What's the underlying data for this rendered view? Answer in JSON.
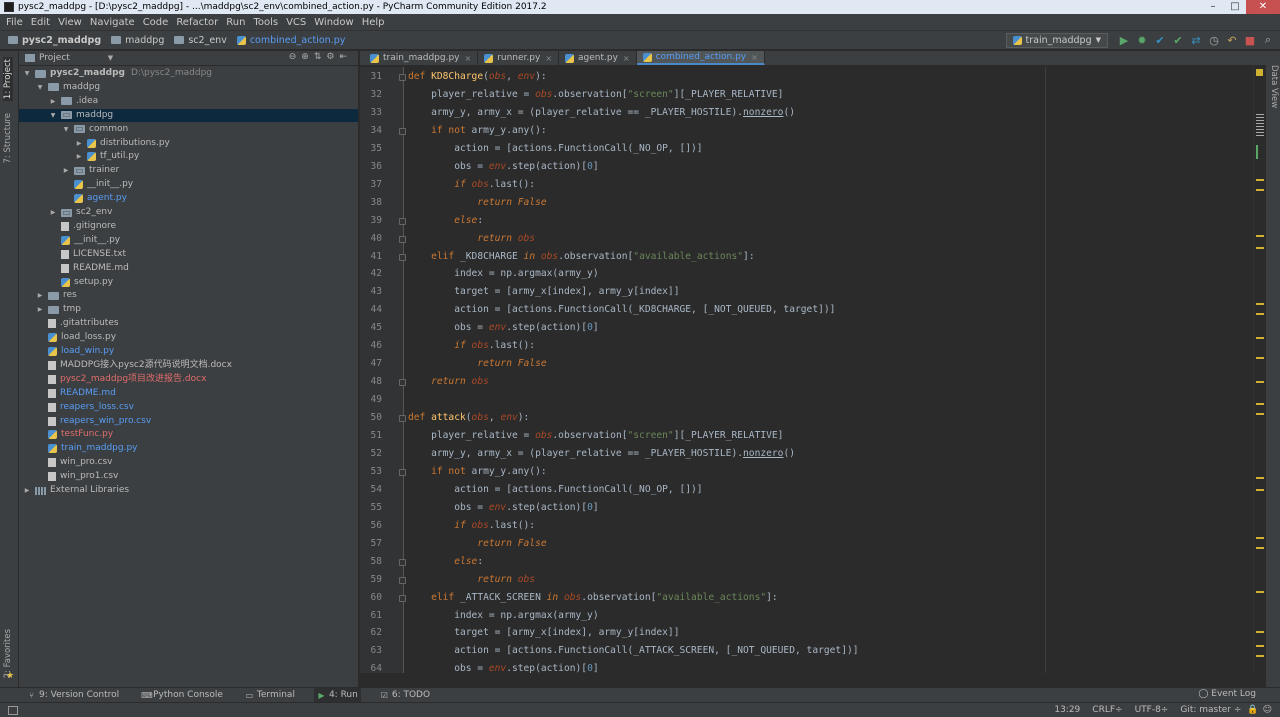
{
  "window": {
    "title": "pysc2_maddpg - [D:\\pysc2_maddpg] - ...\\maddpg\\sc2_env\\combined_action.py - PyCharm Community Edition 2017.2",
    "controls": [
      "–",
      "□",
      "✕"
    ]
  },
  "menu": [
    "File",
    "Edit",
    "View",
    "Navigate",
    "Code",
    "Refactor",
    "Run",
    "Tools",
    "VCS",
    "Window",
    "Help"
  ],
  "breadcrumb": [
    "pysc2_maddpg",
    "maddpg",
    "sc2_env",
    "combined_action.py"
  ],
  "toolbar": {
    "run_config": "train_maddpg",
    "icons": [
      "run-icon",
      "debug-icon",
      "vcs-update-icon",
      "vcs-commit-icon",
      "vcs-compare-icon",
      "vcs-history-icon",
      "revert-icon",
      "stop-icon",
      "search-everywhere-icon"
    ]
  },
  "left_stripe": {
    "project_tab": "1: Project",
    "structure_tab": "7: Structure",
    "favorites_tab": "2: Favorites"
  },
  "project_panel": {
    "header": "Project",
    "tree": [
      {
        "label": "pysc2_maddpg",
        "suffix": "D:\\pysc2_maddpg",
        "indent": 0,
        "type": "folder",
        "open": true,
        "bold": true
      },
      {
        "label": "maddpg",
        "indent": 1,
        "type": "folder",
        "open": true
      },
      {
        "label": ".idea",
        "indent": 2,
        "type": "folder",
        "open": false
      },
      {
        "label": "maddpg",
        "indent": 2,
        "type": "pkg",
        "open": true,
        "selected": true
      },
      {
        "label": "common",
        "indent": 3,
        "type": "pkg",
        "open": true
      },
      {
        "label": "distributions.py",
        "indent": 4,
        "type": "py"
      },
      {
        "label": "tf_util.py",
        "indent": 4,
        "type": "py"
      },
      {
        "label": "trainer",
        "indent": 3,
        "type": "pkg",
        "open": false
      },
      {
        "label": "__init__.py",
        "indent": 3,
        "type": "py",
        "leaf": true
      },
      {
        "label": "agent.py",
        "indent": 3,
        "type": "py",
        "leaf": true,
        "color": "blue"
      },
      {
        "label": "sc2_env",
        "indent": 2,
        "type": "pkg",
        "open": false
      },
      {
        "label": ".gitignore",
        "indent": 2,
        "type": "file",
        "leaf": true
      },
      {
        "label": "__init__.py",
        "indent": 2,
        "type": "py",
        "leaf": true
      },
      {
        "label": "LICENSE.txt",
        "indent": 2,
        "type": "file",
        "leaf": true
      },
      {
        "label": "README.md",
        "indent": 2,
        "type": "file",
        "leaf": true
      },
      {
        "label": "setup.py",
        "indent": 2,
        "type": "py",
        "leaf": true
      },
      {
        "label": "res",
        "indent": 1,
        "type": "folder",
        "open": false
      },
      {
        "label": "tmp",
        "indent": 1,
        "type": "folder",
        "open": false
      },
      {
        "label": ".gitattributes",
        "indent": 1,
        "type": "file",
        "leaf": true
      },
      {
        "label": "load_loss.py",
        "indent": 1,
        "type": "py",
        "leaf": true
      },
      {
        "label": "load_win.py",
        "indent": 1,
        "type": "py",
        "leaf": true,
        "color": "blue"
      },
      {
        "label": "MADDPG接入pysc2源代码说明文档.docx",
        "indent": 1,
        "type": "file",
        "leaf": true
      },
      {
        "label": "pysc2_maddpg项目改进报告.docx",
        "indent": 1,
        "type": "file",
        "leaf": true,
        "color": "red"
      },
      {
        "label": "README.md",
        "indent": 1,
        "type": "file",
        "leaf": true,
        "color": "blue"
      },
      {
        "label": "reapers_loss.csv",
        "indent": 1,
        "type": "file",
        "leaf": true,
        "color": "blue"
      },
      {
        "label": "reapers_win_pro.csv",
        "indent": 1,
        "type": "file",
        "leaf": true,
        "color": "blue"
      },
      {
        "label": "testFunc.py",
        "indent": 1,
        "type": "py",
        "leaf": true,
        "color": "red"
      },
      {
        "label": "train_maddpg.py",
        "indent": 1,
        "type": "py",
        "leaf": true,
        "color": "blue"
      },
      {
        "label": "win_pro.csv",
        "indent": 1,
        "type": "file",
        "leaf": true
      },
      {
        "label": "win_pro1.csv",
        "indent": 1,
        "type": "file",
        "leaf": true
      },
      {
        "label": "External Libraries",
        "indent": 0,
        "type": "libs",
        "open": false
      }
    ]
  },
  "editor_tabs": [
    {
      "label": "train_maddpg.py",
      "active": false
    },
    {
      "label": "runner.py",
      "active": false
    },
    {
      "label": "agent.py",
      "active": false
    },
    {
      "label": "combined_action.py",
      "active": true
    }
  ],
  "editor": {
    "first_line": 31,
    "lines": [
      "<span class=\"kwn\">def </span><span class=\"fn\">KD8Charge</span>(<span class=\"prm\">obs</span>, <span class=\"prm\">env</span>):",
      "    player_relative = <span class=\"prm\">obs</span>.observation[<span class=\"str\">\"screen\"</span>][_PLAYER_RELATIVE]",
      "    army_y, army_x = (player_relative == _PLAYER_HOSTILE).<span class=\"und\">nonzero</span>()",
      "    <span class=\"kwn\">if not </span>army_y.any():",
      "        action = [actions.FunctionCall(_NO_OP, [])]",
      "        obs = <span class=\"prm\">env</span>.step(action)[<span class=\"num\">0</span>]",
      "        <span class=\"kw\">if </span><span class=\"prm\">obs</span>.last():",
      "            <span class=\"kw\">return False</span>",
      "        <span class=\"kw\">else</span>:",
      "            <span class=\"kw\">return </span><span class=\"prm\">obs</span>",
      "    <span class=\"kwn\">elif </span>_KD8CHARGE <span class=\"kw\">in </span><span class=\"prm\">obs</span>.observation[<span class=\"str\">\"available_actions\"</span>]:",
      "        index = np.argmax(army_y)",
      "        target = [army_x[index], army_y[index]]",
      "        action = [actions.FunctionCall(_KD8CHARGE, [_NOT_QUEUED, target])]",
      "        obs = <span class=\"prm\">env</span>.step(action)[<span class=\"num\">0</span>]",
      "        <span class=\"kw\">if </span><span class=\"prm\">obs</span>.last():",
      "            <span class=\"kw\">return False</span>",
      "    <span class=\"kw\">return </span><span class=\"prm\">obs</span>",
      "",
      "<span class=\"kwn\">def </span><span class=\"fn\">attack</span>(<span class=\"prm\">obs</span>, <span class=\"prm\">env</span>):",
      "    player_relative = <span class=\"prm\">obs</span>.observation[<span class=\"str\">\"screen\"</span>][_PLAYER_RELATIVE]",
      "    army_y, army_x = (player_relative == _PLAYER_HOSTILE).<span class=\"und\">nonzero</span>()",
      "    <span class=\"kwn\">if not </span>army_y.any():",
      "        action = [actions.FunctionCall(_NO_OP, [])]",
      "        obs = <span class=\"prm\">env</span>.step(action)[<span class=\"num\">0</span>]",
      "        <span class=\"kw\">if </span><span class=\"prm\">obs</span>.last():",
      "            <span class=\"kw\">return False</span>",
      "        <span class=\"kw\">else</span>:",
      "            <span class=\"kw\">return </span><span class=\"prm\">obs</span>",
      "    <span class=\"kwn\">elif </span>_ATTACK_SCREEN <span class=\"kw\">in </span><span class=\"prm\">obs</span>.observation[<span class=\"str\">\"available_actions\"</span>]:",
      "        index = np.argmax(army_y)",
      "        target = [army_x[index], army_y[index]]",
      "        action = [actions.FunctionCall(_ATTACK_SCREEN, [_NOT_QUEUED, target])]",
      "        obs = <span class=\"prm\">env</span>.step(action)[<span class=\"num\">0</span>]"
    ]
  },
  "bottom_tools": [
    {
      "label": "9: Version Control",
      "icon": "version-control-icon"
    },
    {
      "label": "Python Console",
      "icon": "python-console-icon"
    },
    {
      "label": "Terminal",
      "icon": "terminal-icon"
    },
    {
      "label": "4: Run",
      "icon": "run-icon",
      "active": true
    },
    {
      "label": "6: TODO",
      "icon": "todo-icon"
    }
  ],
  "event_log": "Event Log",
  "status": {
    "position": "13:29",
    "line_sep": "CRLF÷",
    "encoding": "UTF-8÷",
    "git": "Git: master ÷"
  },
  "colors": {
    "accent": "#4a88c7",
    "link": "#589df6",
    "modified": "#e06c6c"
  }
}
